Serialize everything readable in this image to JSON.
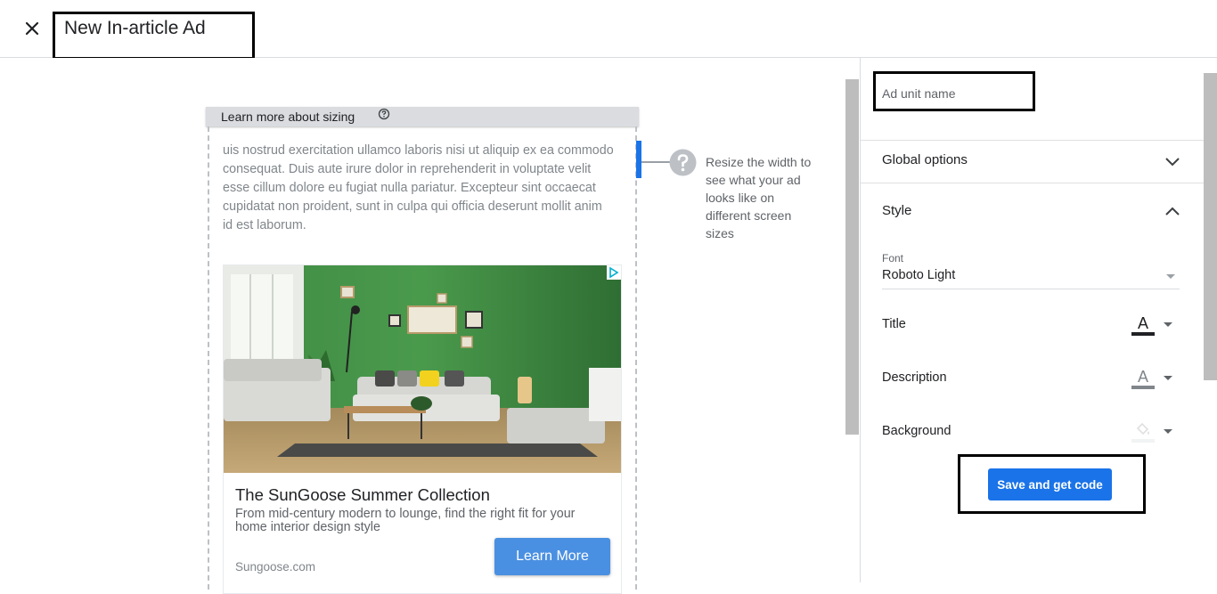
{
  "header": {
    "title": "New In-article Ad",
    "close_icon": "close-icon"
  },
  "preview": {
    "sizing_link": "Learn more about sizing",
    "sizing_help_icon": "help-circle-icon",
    "lorem_text": "uis nostrud exercitation ullamco laboris nisi ut aliquip ex ea commodo consequat. Duis aute irure dolor in reprehenderit in voluptate velit esse cillum dolore eu fugiat nulla pariatur. Excepteur sint occaecat cupidatat non proident, sunt in culpa qui officia deserunt mollit anim id est laborum.",
    "resize_hint": "Resize the width to see what your ad looks like on different screen sizes",
    "resize_hint_icon": "question-icon",
    "ad": {
      "title": "The SunGoose Summer Collection",
      "description": "From mid-century modern to lounge, find the right fit for your home interior design style",
      "domain": "Sungoose.com",
      "cta": "Learn More",
      "adchoices_icon": "adchoices-icon"
    }
  },
  "panel": {
    "ad_unit_name_placeholder": "Ad unit name",
    "sections": {
      "global_options": "Global options",
      "style": "Style"
    },
    "font": {
      "caption": "Font",
      "value": "Roboto Light"
    },
    "style_rows": [
      {
        "label": "Title",
        "icon": "text-color-icon",
        "swatch": "#202124"
      },
      {
        "label": "Description",
        "icon": "text-color-icon",
        "swatch": "#80868b"
      },
      {
        "label": "Background",
        "icon": "fill-color-icon",
        "swatch": "#f1f3f4"
      }
    ],
    "save_button": "Save and get code"
  },
  "colors": {
    "primary": "#1a73e8",
    "cta": "#4a90e2"
  }
}
